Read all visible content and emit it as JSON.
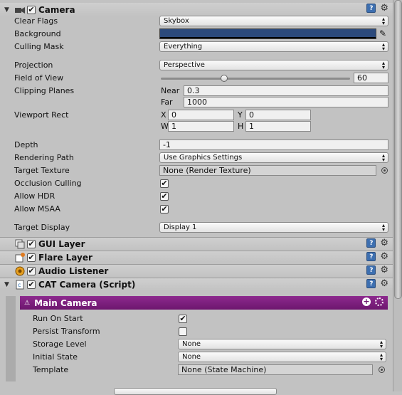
{
  "camera": {
    "title": "Camera",
    "clear_flags": {
      "label": "Clear Flags",
      "value": "Skybox"
    },
    "background": {
      "label": "Background",
      "color": "#2c4a7c"
    },
    "culling_mask": {
      "label": "Culling Mask",
      "value": "Everything"
    },
    "projection": {
      "label": "Projection",
      "value": "Perspective"
    },
    "field_of_view": {
      "label": "Field of View",
      "value": "60",
      "slider_fraction": 0.333
    },
    "clipping_planes": {
      "label": "Clipping Planes",
      "near_label": "Near",
      "near": "0.3",
      "far_label": "Far",
      "far": "1000"
    },
    "viewport_rect": {
      "label": "Viewport Rect",
      "x_label": "X",
      "x": "0",
      "y_label": "Y",
      "y": "0",
      "w_label": "W",
      "w": "1",
      "h_label": "H",
      "h": "1"
    },
    "depth": {
      "label": "Depth",
      "value": "-1"
    },
    "rendering_path": {
      "label": "Rendering Path",
      "value": "Use Graphics Settings"
    },
    "target_texture": {
      "label": "Target Texture",
      "value": "None (Render Texture)"
    },
    "occlusion_culling": {
      "label": "Occlusion Culling",
      "checked": true
    },
    "allow_hdr": {
      "label": "Allow HDR",
      "checked": true
    },
    "allow_msaa": {
      "label": "Allow MSAA",
      "checked": true
    },
    "target_display": {
      "label": "Target Display",
      "value": "Display 1"
    }
  },
  "components": [
    {
      "title": "GUI Layer",
      "icon": "gui-layer-icon"
    },
    {
      "title": "Flare Layer",
      "icon": "flare-layer-icon"
    },
    {
      "title": "Audio Listener",
      "icon": "audio-listener-icon"
    },
    {
      "title": "CAT Camera (Script)",
      "icon": "script-icon"
    }
  ],
  "cat_camera": {
    "section_title": "Main Camera",
    "run_on_start": {
      "label": "Run On Start",
      "checked": true
    },
    "persist_transform": {
      "label": "Persist Transform",
      "checked": false
    },
    "storage_level": {
      "label": "Storage Level",
      "value": "None"
    },
    "initial_state": {
      "label": "Initial State",
      "value": "None"
    },
    "template": {
      "label": "Template",
      "value": "None (State Machine)"
    }
  },
  "icons": {
    "help": "?",
    "gear": "⚙",
    "check": "✔",
    "arrow": "▲▼"
  },
  "colors": {
    "accent_purple": "#7a1f7b",
    "help_blue": "#3d6fb0"
  }
}
